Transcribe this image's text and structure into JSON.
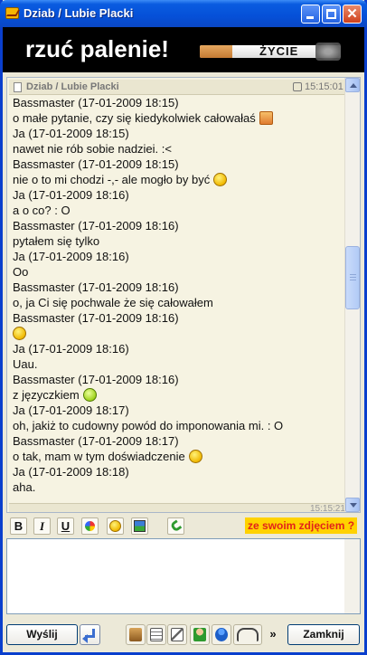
{
  "window": {
    "title": "Dziab / Lubie Placki"
  },
  "banner": {
    "text": "rzuć palenie!",
    "cigarette_label": "ŻYCIE"
  },
  "chat": {
    "header_title": "Dziab / Lubie Placki",
    "header_time": "15:15:01",
    "lines": [
      {
        "text": "Bassmaster (17-01-2009 18:15)",
        "emoticon": ""
      },
      {
        "text": "o małe pytanie, czy się kiedykolwiek całowałaś",
        "emoticon": "confused-box"
      },
      {
        "text": "Ja (17-01-2009 18:15)",
        "emoticon": ""
      },
      {
        "text": "nawet nie rób sobie nadziei. :<",
        "emoticon": ""
      },
      {
        "text": "Bassmaster (17-01-2009 18:15)",
        "emoticon": ""
      },
      {
        "text": "nie o to mi chodzi -,- ale mogło by być",
        "emoticon": "tongue"
      },
      {
        "text": "Ja (17-01-2009 18:16)",
        "emoticon": ""
      },
      {
        "text": "a o co? : O",
        "emoticon": ""
      },
      {
        "text": "Bassmaster (17-01-2009 18:16)",
        "emoticon": ""
      },
      {
        "text": "pytałem się tylko",
        "emoticon": ""
      },
      {
        "text": "Ja (17-01-2009 18:16)",
        "emoticon": ""
      },
      {
        "text": "Oo",
        "emoticon": ""
      },
      {
        "text": "Bassmaster (17-01-2009 18:16)",
        "emoticon": ""
      },
      {
        "text": "o, ja Ci się pochwale że się całowałem",
        "emoticon": ""
      },
      {
        "text": "Bassmaster (17-01-2009 18:16)",
        "emoticon": ""
      },
      {
        "text": "",
        "emoticon": "grin"
      },
      {
        "text": "Ja (17-01-2009 18:16)",
        "emoticon": ""
      },
      {
        "text": "Uau.",
        "emoticon": ""
      },
      {
        "text": "Bassmaster (17-01-2009 18:16)",
        "emoticon": ""
      },
      {
        "text": "z języczkiem",
        "emoticon": "green-tongue"
      },
      {
        "text": "Ja (17-01-2009 18:17)",
        "emoticon": ""
      },
      {
        "text": "oh, jakiż to cudowny powód do imponowania mi. : O",
        "emoticon": ""
      },
      {
        "text": "Bassmaster (17-01-2009 18:17)",
        "emoticon": ""
      },
      {
        "text": "o tak, mam w tym doświadczenie",
        "emoticon": "grimace"
      },
      {
        "text": "Ja (17-01-2009 18:18)",
        "emoticon": ""
      },
      {
        "text": "aha.",
        "emoticon": ""
      }
    ],
    "next_header_time": "15:15:21"
  },
  "format_toolbar": {
    "bold": "B",
    "italic": "I",
    "underline": "U",
    "promo": "ze swoim zdjęciem ?"
  },
  "input": {
    "value": "",
    "placeholder": ""
  },
  "bottom": {
    "send_label": "Wyślij",
    "close_label": "Zamknij",
    "more_label": "»"
  },
  "colors": {
    "titlebar": "#0550d8",
    "banner_bg": "#000000",
    "promo_bg": "#ffd200",
    "promo_text": "#e2231a"
  }
}
